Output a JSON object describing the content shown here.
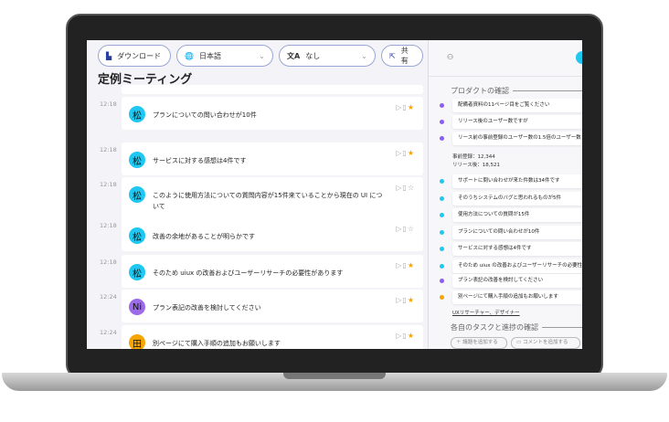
{
  "toolbar": {
    "download": "ダウンロード",
    "language": "日本語",
    "translation": "なし",
    "share": "共有"
  },
  "page_title": "定例ミーティング",
  "messages": [
    {
      "time": "12:18",
      "avatar": "松",
      "text": "プランについての問い合わせが10件",
      "starred": true
    },
    {
      "time": "12:18",
      "avatar": "松",
      "text": "サービスに対する感想は4件です",
      "starred": true
    },
    {
      "time": "12:18",
      "avatar": "松",
      "text": "このように使用方法についての質問内容が15件来ていることから現在の UI について",
      "starred": false
    },
    {
      "time": "12:18",
      "avatar": "松",
      "text": "改善の余地があることが明らかです",
      "starred": false
    },
    {
      "time": "12:18",
      "avatar": "松",
      "text": "そのため uiux の改善およびユーザーリサーチの必要性があります",
      "starred": true
    },
    {
      "time": "12:24",
      "avatar": "Ni",
      "text": "プラン表記の改善を検討してください",
      "starred": true
    },
    {
      "time": "12:24",
      "avatar": "田",
      "text": "別ページにて購入手順の追加もお願いします",
      "starred": true
    }
  ],
  "colors": {
    "matsu": "#1ec8f0",
    "ni": "#9b6be8",
    "ta": "#f5a400",
    "purple": "#8b5cf6",
    "cyan": "#1ec8f0",
    "orange": "#f5a400"
  },
  "right": {
    "section1": "プロダクトの確認",
    "items_a": [
      "配備者資料の11ページ目をご覧ください",
      "リリース後のユーザー数ですが",
      "リース前の事前登録のユーザー数の1.5倍のユーザー数"
    ],
    "note1": "事前登録：12,344",
    "note2": "リリース後：18,521",
    "items_b": [
      "サポートに問い合わせが来た件数は34件です",
      "そのうちシステムのバグと思われるものが5件",
      "使用方法についての質問が15件",
      "プランについての問い合わせが10件",
      "サービスに対する感想は4件です",
      "そのため uiux の改善およびユーザーリサーチの必要性"
    ],
    "item_c": "プラン表記の改善を検討してください",
    "item_d": "別ページにて購入手順の追加もお願いします",
    "assignees": "UXリサーチャー、デザイナー",
    "section2": "各自のタスクと進捗の確認",
    "add_topic": "議題を追加する",
    "add_comment": "コメントを追加する"
  }
}
